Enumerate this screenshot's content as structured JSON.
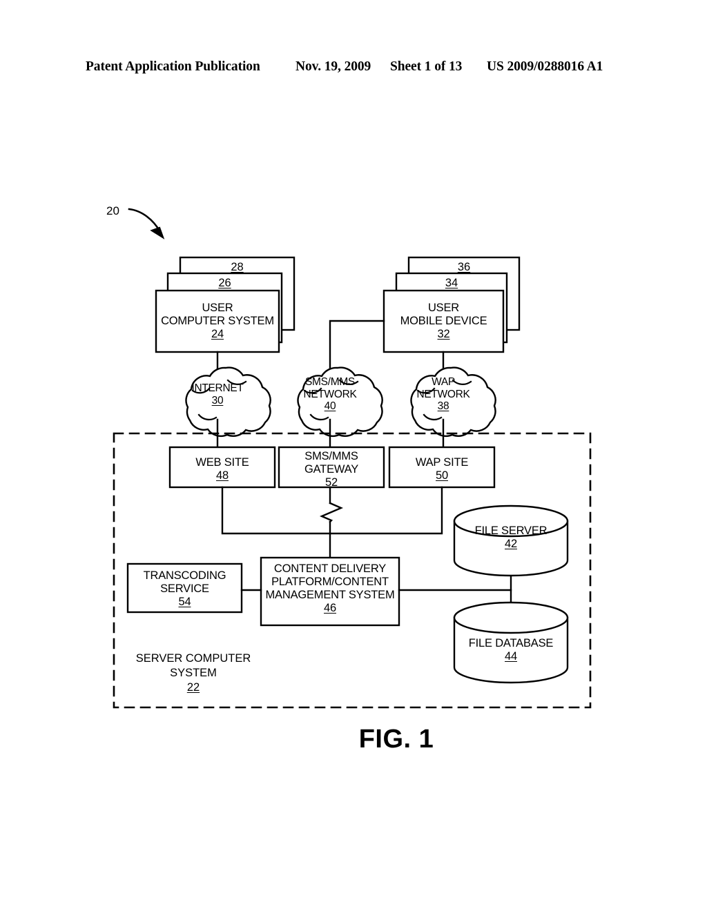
{
  "header": {
    "publication": "Patent Application Publication",
    "date": "Nov. 19, 2009",
    "sheet": "Sheet 1 of 13",
    "patent_number": "US 2009/0288016 A1"
  },
  "figure": {
    "caption": "FIG. 1",
    "system_reference": "20"
  },
  "user_computer_stack": {
    "back_ref": "28",
    "middle_ref": "26",
    "front_line1": "USER",
    "front_line2": "COMPUTER SYSTEM",
    "front_ref": "24"
  },
  "user_mobile_stack": {
    "back_ref": "36",
    "middle_ref": "34",
    "front_line1": "USER",
    "front_line2": "MOBILE DEVICE",
    "front_ref": "32"
  },
  "clouds": [
    {
      "line1": "INTERNET",
      "line2": "",
      "ref": "30"
    },
    {
      "line1": "SMS/MMS",
      "line2": "NETWORK",
      "ref": "40"
    },
    {
      "line1": "WAP",
      "line2": "NETWORK",
      "ref": "38"
    }
  ],
  "gateways": [
    {
      "line1": "WEB SITE",
      "line2": "",
      "ref": "48"
    },
    {
      "line1": "SMS/MMS",
      "line2": "GATEWAY",
      "ref": "52"
    },
    {
      "line1": "WAP SITE",
      "line2": "",
      "ref": "50"
    }
  ],
  "transcoding": {
    "line1": "TRANSCODING",
    "line2": "SERVICE",
    "ref": "54"
  },
  "content_platform": {
    "line1": "CONTENT DELIVERY",
    "line2": "PLATFORM/CONTENT",
    "line3": "MANAGEMENT SYSTEM",
    "ref": "46"
  },
  "file_server": {
    "line1": "FILE SERVER",
    "ref": "42"
  },
  "file_database": {
    "line1": "FILE DATABASE",
    "ref": "44"
  },
  "enclosure": {
    "line1": "SERVER COMPUTER",
    "line2": "SYSTEM",
    "ref": "22"
  },
  "colors": {
    "ink": "#000000",
    "paper": "#ffffff"
  }
}
